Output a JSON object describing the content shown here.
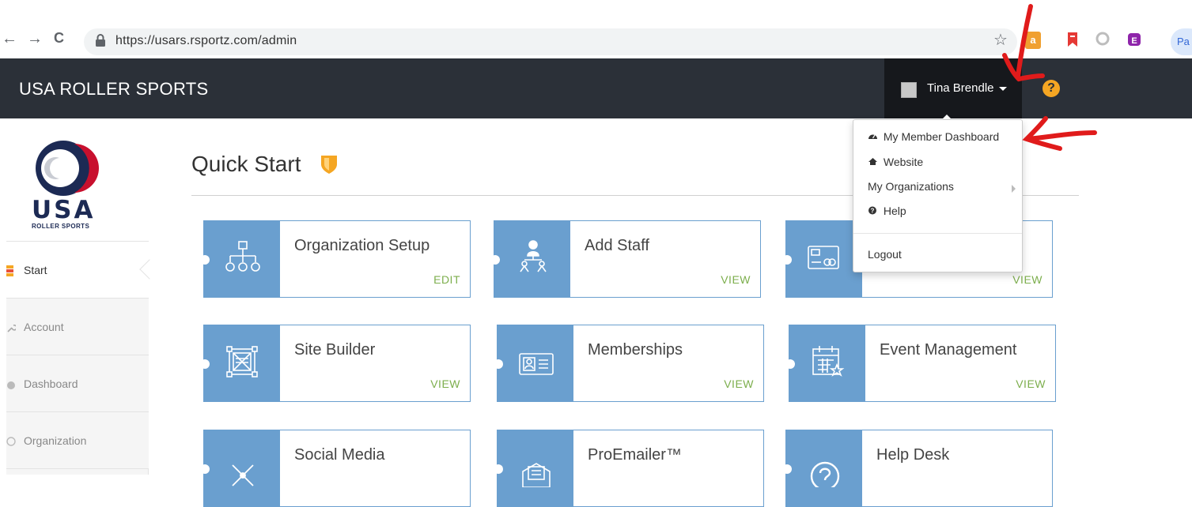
{
  "browser": {
    "back": "←",
    "forward": "→",
    "reload": "C",
    "url": "https://usars.rsportz.com/admin",
    "bookmark_star": "☆",
    "extensions": [
      {
        "label": "a",
        "color": "#f0a030"
      },
      {
        "label": "",
        "color": "#e53935"
      },
      {
        "label": "",
        "color": "#bdbdbd"
      },
      {
        "label": "",
        "color": "#8e24aa"
      }
    ],
    "profile": "Pa"
  },
  "header": {
    "brand": "USA ROLLER SPORTS",
    "user_name": "Tina Brendle",
    "help": "?"
  },
  "sidebar": {
    "logo_text": "USA",
    "logo_sub": "ROLLER SPORTS",
    "items": [
      {
        "label": "Start",
        "icon": "start-icon"
      },
      {
        "label": "Account",
        "icon": "wrench-icon"
      },
      {
        "label": "Dashboard",
        "icon": "dashboard-icon"
      },
      {
        "label": "Organization",
        "icon": "organization-icon"
      }
    ]
  },
  "main": {
    "title": "Quick Start",
    "tiles": [
      {
        "title": "Organization Setup",
        "action": "EDIT",
        "icon": "org-chart-icon"
      },
      {
        "title": "Add Staff",
        "action": "VIEW",
        "icon": "staff-icon"
      },
      {
        "title": "",
        "action": "VIEW",
        "icon": "payment-card-icon"
      },
      {
        "title": "Site Builder",
        "action": "VIEW",
        "icon": "site-builder-icon"
      },
      {
        "title": "Memberships",
        "action": "VIEW",
        "icon": "membership-card-icon"
      },
      {
        "title": "Event Management",
        "action": "VIEW",
        "icon": "calendar-star-icon"
      },
      {
        "title": "Social Media",
        "action": "",
        "icon": "network-icon"
      },
      {
        "title": "ProEmailer™",
        "action": "",
        "icon": "envelope-icon"
      },
      {
        "title": "Help Desk",
        "action": "",
        "icon": "help-circle-icon"
      }
    ]
  },
  "dropdown": {
    "items": [
      {
        "label": "My Member Dashboard",
        "icon": "dashboard-icon"
      },
      {
        "label": "Website",
        "icon": "home-icon"
      },
      {
        "label": "My Organizations",
        "icon": ""
      },
      {
        "label": "Help",
        "icon": "question-icon"
      }
    ],
    "logout": "Logout"
  },
  "colors": {
    "header_bg": "#2b3038",
    "tile_blue": "#6a9fcf",
    "action_green": "#7cae4c",
    "accent_orange": "#f5a623",
    "annotation_red": "#e01b1b"
  }
}
